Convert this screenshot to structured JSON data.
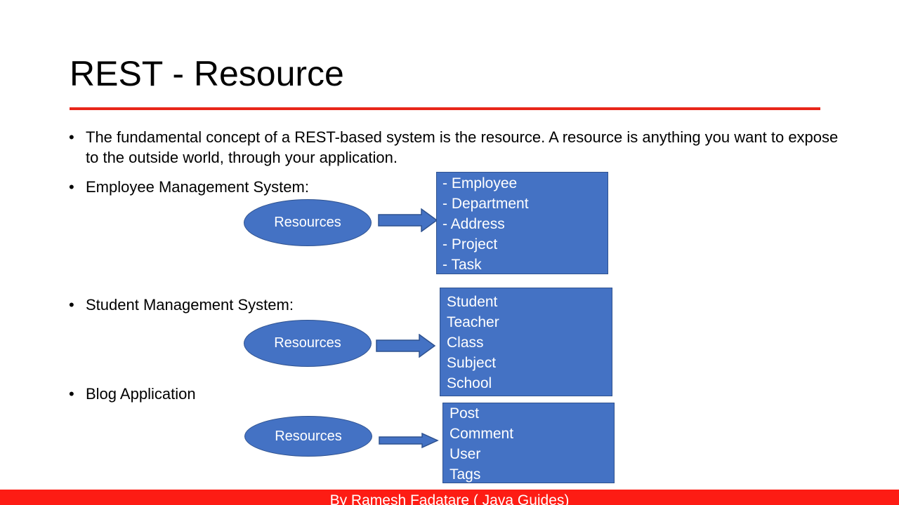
{
  "slide": {
    "title": "REST - Resource",
    "intro": "The fundamental concept of a REST-based system is the resource. A resource is anything you want to expose to the outside world, through your application.",
    "bullet_symbol": "•",
    "footer": "By Ramesh Fadatare ( Java Guides)",
    "colors": {
      "accent_red": "#e8261a",
      "footer_red": "#fd1c14",
      "shape_blue": "#4472c4"
    }
  },
  "sections": [
    {
      "label": "Employee Management System:",
      "node": "Resources",
      "items": [
        "- Employee",
        "- Department",
        "- Address",
        "- Project",
        "- Task"
      ]
    },
    {
      "label": "Student Management System:",
      "node": "Resources",
      "items": [
        "Student",
        "Teacher",
        "Class",
        "Subject",
        "School"
      ]
    },
    {
      "label": "Blog Application",
      "node": "Resources",
      "items": [
        "Post",
        "Comment",
        "User",
        "Tags"
      ]
    }
  ]
}
